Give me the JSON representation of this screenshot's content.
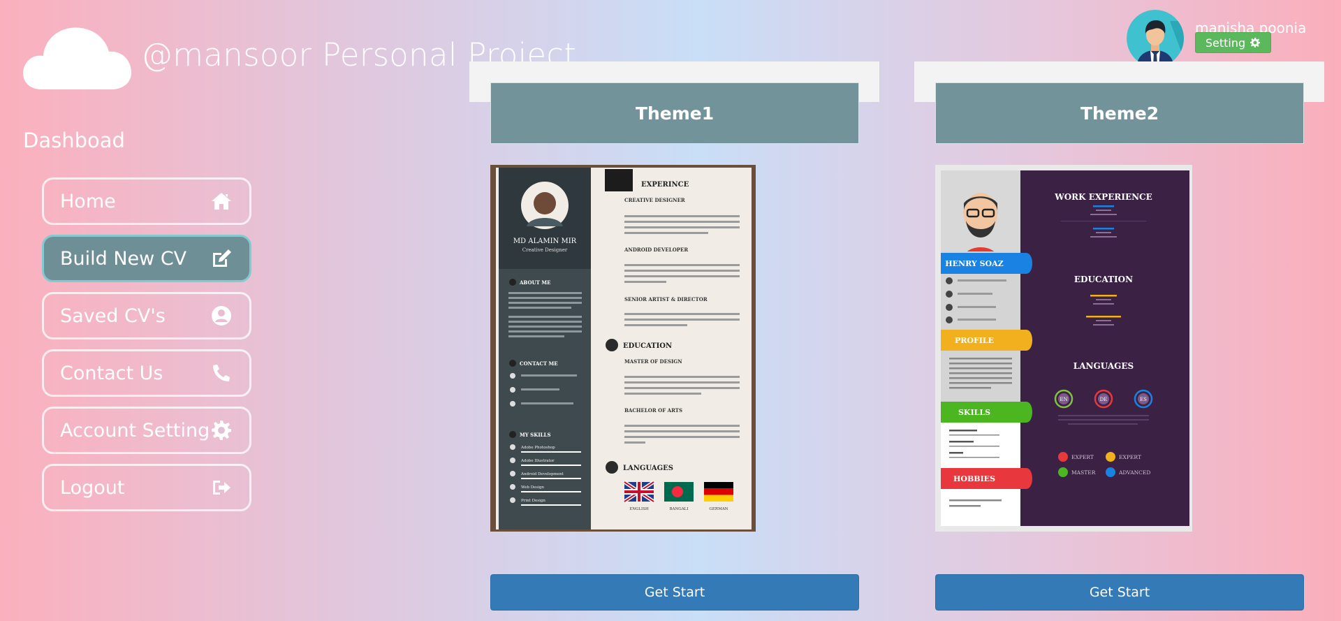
{
  "brand": {
    "title": "@mansoor Personal Project"
  },
  "sidebar": {
    "title": "Dashboad",
    "items": [
      {
        "label": "Home",
        "icon": "home-icon"
      },
      {
        "label": "Build New CV",
        "icon": "edit-icon",
        "active": true
      },
      {
        "label": "Saved CV's",
        "icon": "user-circle-icon"
      },
      {
        "label": "Contact Us",
        "icon": "phone-icon"
      },
      {
        "label": "Account Setting",
        "icon": "gear-icon"
      },
      {
        "label": "Logout",
        "icon": "sign-out-icon"
      }
    ]
  },
  "user": {
    "name": "manisha poonia",
    "setting_label": "Setting"
  },
  "themes": [
    {
      "title": "Theme1",
      "button": "Get Start",
      "resume": {
        "name": "MD ALAMIN MIR",
        "role": "Creative Designer",
        "about": "ABOUT ME",
        "contact": "CONTACT ME",
        "skills": "MY SKILLS",
        "skill_items": [
          "Adobe Photoshop",
          "Adobe Illustrator",
          "Android Development",
          "Web Design",
          "Print Design"
        ],
        "experience": "EXPERINCE",
        "jobs": [
          "CREATIVE DESIGNER",
          "ANDROID DEVELOPER",
          "SENIOR ARTIST & DIRECTOR"
        ],
        "education": "EDUCATION",
        "degrees": [
          "MASTER OF DESIGN",
          "BACHELOR OF ARTS"
        ],
        "languages": "LANGUAGES",
        "lang_items": [
          "ENGLISH",
          "BANGALI",
          "GERMAN"
        ]
      }
    },
    {
      "title": "Theme2",
      "button": "Get Start",
      "resume": {
        "name": "HENRY SOAZ",
        "work": "WORK EXPERIENCE",
        "education": "EDUCATION",
        "languages": "LANGUAGES",
        "profile": "PROFILE",
        "skills": "SKILLS",
        "hobbies": "HOBBIES",
        "level_tags": [
          "EN",
          "DE",
          "ES"
        ],
        "expertise": [
          "EXPERT",
          "EXPERT",
          "MASTER",
          "ADVANCED"
        ]
      }
    }
  ],
  "colors": {
    "accent": "#337ab7",
    "setting": "#5cb85c",
    "header": "#73939a"
  }
}
